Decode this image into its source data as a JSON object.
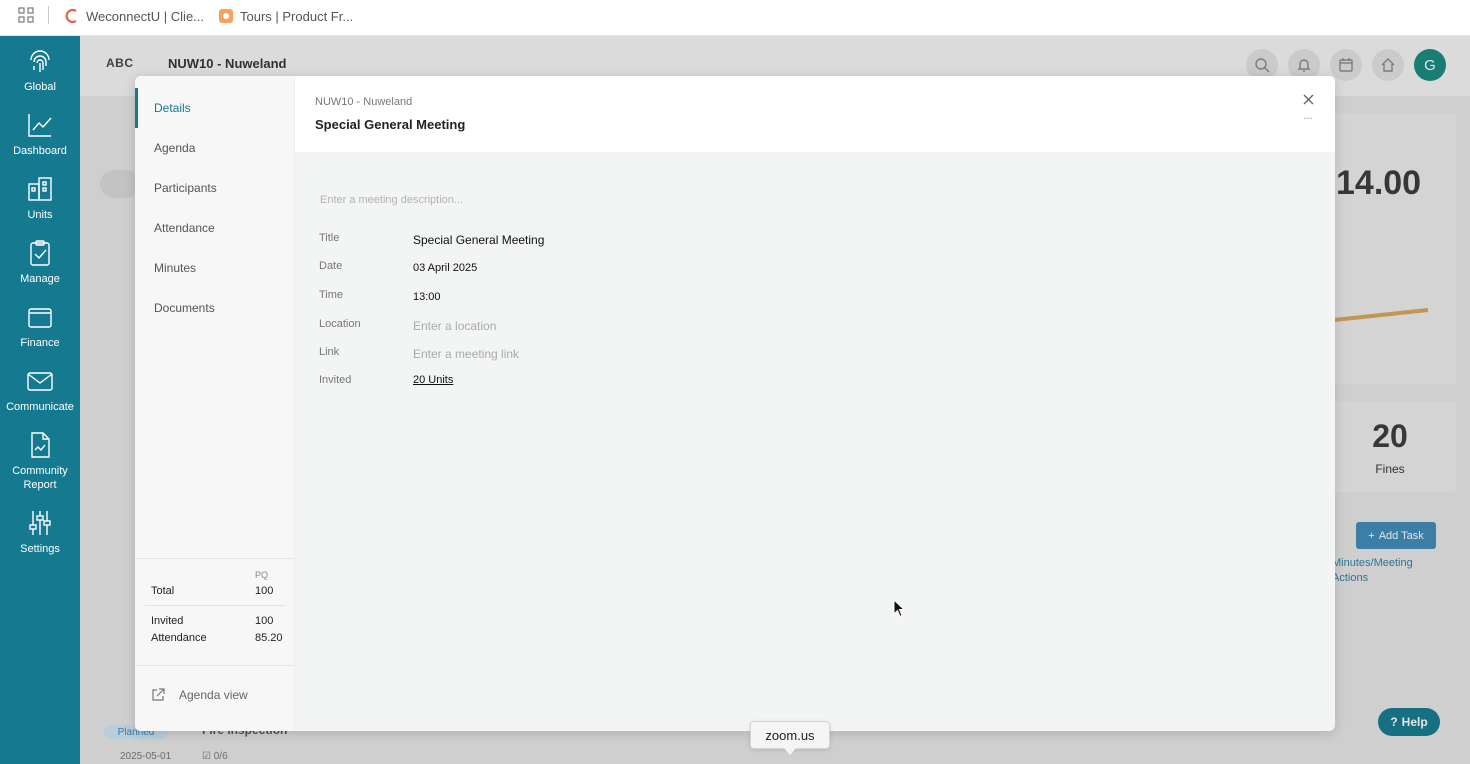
{
  "browser": {
    "bookmarks": [
      {
        "label": "WeconnectU | Clie..."
      },
      {
        "label": "Tours | Product Fr..."
      }
    ]
  },
  "sidebar": {
    "items": [
      {
        "label": "Global",
        "icon": "fingerprint-icon"
      },
      {
        "label": "Dashboard",
        "icon": "chart-line-icon"
      },
      {
        "label": "Units",
        "icon": "building-icon"
      },
      {
        "label": "Manage",
        "icon": "clipboard-check-icon"
      },
      {
        "label": "Finance",
        "icon": "wallet-icon"
      },
      {
        "label": "Communicate",
        "icon": "envelope-icon"
      },
      {
        "label": "Community Report",
        "icon": "report-document-icon"
      },
      {
        "label": "Settings",
        "icon": "sliders-icon"
      }
    ]
  },
  "app": {
    "logo": "ABC",
    "title": "NUW10 - Nuweland",
    "avatar_initial": "G",
    "stat_value": "14.00",
    "fines_count": "20",
    "fines_label": "Fines",
    "add_task_label": "Add Task",
    "minutes_link": "Minutes/Meeting Actions",
    "help_label": "Help",
    "bg_task": {
      "status": "Planned",
      "title": "Fire Inspection",
      "date": "2025-05-01",
      "checklist": "0/6"
    }
  },
  "modal": {
    "nav": [
      {
        "label": "Details"
      },
      {
        "label": "Agenda"
      },
      {
        "label": "Participants"
      },
      {
        "label": "Attendance"
      },
      {
        "label": "Minutes"
      },
      {
        "label": "Documents"
      }
    ],
    "stats": {
      "column_header": "PQ",
      "total_label": "Total",
      "total_value": "100",
      "invited_label": "Invited",
      "invited_value": "100",
      "attendance_label": "Attendance",
      "attendance_value": "85.20"
    },
    "agenda_view_label": "Agenda view",
    "breadcrumb": "NUW10 - Nuweland",
    "title": "Special General Meeting",
    "more_label": "...",
    "description_placeholder": "Enter a meeting description...",
    "fields": {
      "title_label": "Title",
      "title_value": "Special General Meeting",
      "date_label": "Date",
      "date_value": "03 April 2025",
      "time_label": "Time",
      "time_value": "13:00",
      "location_label": "Location",
      "location_placeholder": "Enter a location",
      "link_label": "Link",
      "link_placeholder": "Enter a meeting link",
      "invited_label": "Invited",
      "invited_value": "20 Units"
    }
  },
  "tooltip": {
    "label": "zoom.us"
  },
  "colors": {
    "brand": "#157a8f",
    "accent_button": "#3f8ab8",
    "avatar": "#16897f"
  }
}
